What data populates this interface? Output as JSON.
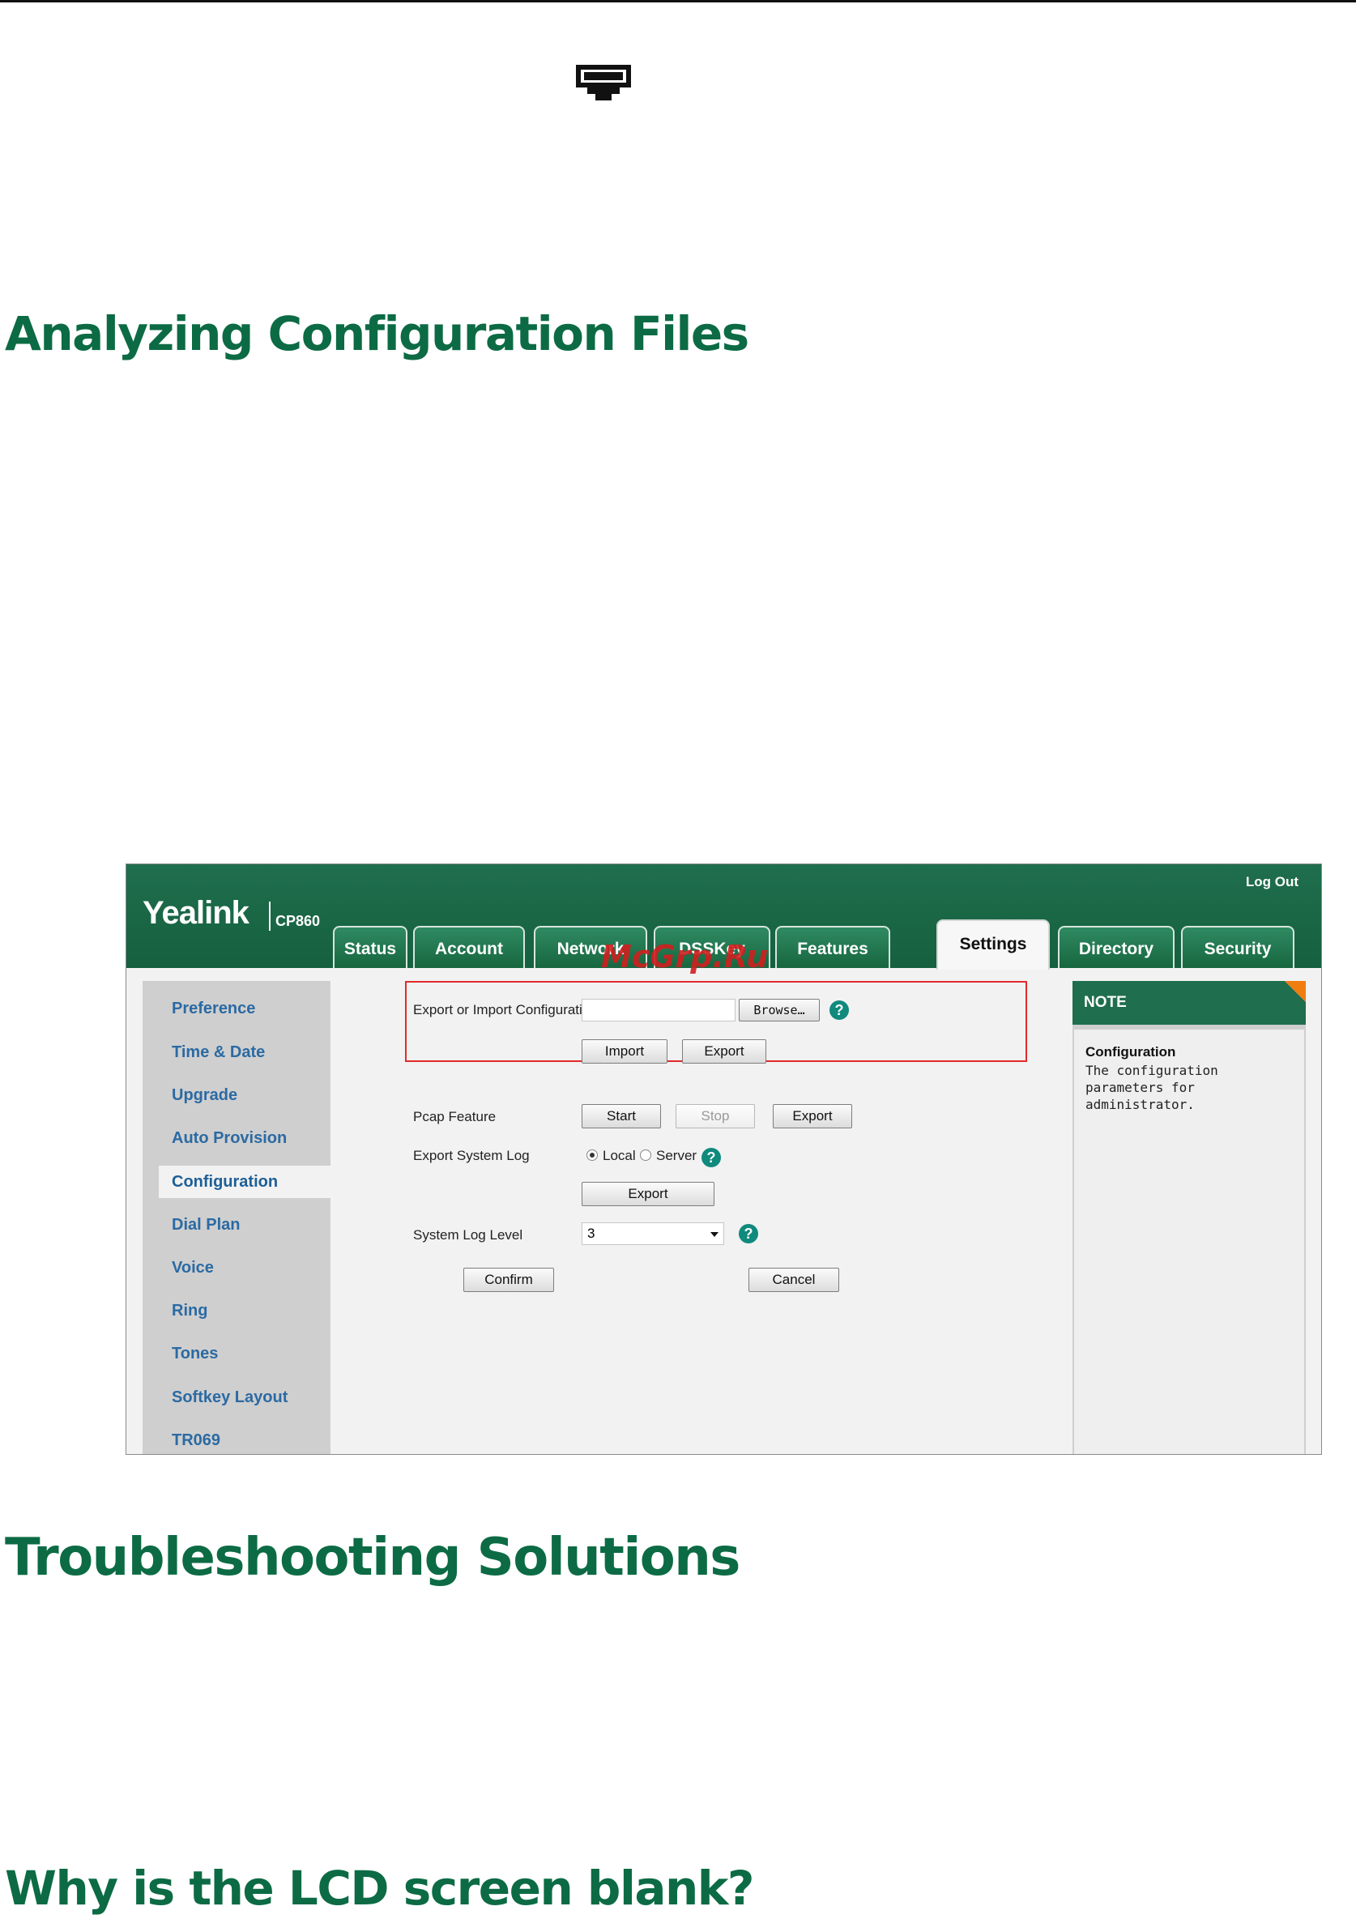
{
  "headings": {
    "analyzing": "Analyzing Configuration Files",
    "troubleshooting": "Troubleshooting Solutions",
    "lcd": "Why is the LCD screen blank?"
  },
  "screenshot": {
    "logo": "Yealink",
    "model": "CP860",
    "logout": "Log Out",
    "watermark": "McGrp.Ru",
    "tabs": [
      {
        "label": "Status"
      },
      {
        "label": "Account"
      },
      {
        "label": "Network"
      },
      {
        "label": "DSSKey"
      },
      {
        "label": "Features"
      },
      {
        "label": "Settings",
        "active": true
      },
      {
        "label": "Directory"
      },
      {
        "label": "Security"
      }
    ],
    "sidebar": [
      {
        "label": "Preference"
      },
      {
        "label": "Time & Date"
      },
      {
        "label": "Upgrade"
      },
      {
        "label": "Auto Provision"
      },
      {
        "label": "Configuration",
        "active": true
      },
      {
        "label": "Dial Plan"
      },
      {
        "label": "Voice"
      },
      {
        "label": "Ring"
      },
      {
        "label": "Tones"
      },
      {
        "label": "Softkey Layout"
      },
      {
        "label": "TR069"
      }
    ],
    "form": {
      "export_import_label": "Export or Import Configuration",
      "file_value": "",
      "browse_label": "Browse…",
      "import_label": "Import",
      "export_label": "Export",
      "pcap_label": "Pcap Feature",
      "start_label": "Start",
      "stop_label": "Stop",
      "pcap_export_label": "Export",
      "syslog_label": "Export System Log",
      "local_label": "Local",
      "server_label": "Server",
      "syslog_selected": "Local",
      "syslog_export_label": "Export",
      "log_level_label": "System Log Level",
      "log_level_value": "3",
      "confirm_label": "Confirm",
      "cancel_label": "Cancel",
      "help_glyph": "?"
    },
    "note": {
      "header": "NOTE",
      "title": "Configuration",
      "text": "The configuration parameters for administrator."
    }
  },
  "colors": {
    "heading_green": "#0c6b44",
    "bar_green": "#1f6e4d",
    "link_blue": "#2b6aa3",
    "highlight_red": "#e02a2a",
    "note_corner_orange": "#f07d10"
  },
  "icons": {
    "top": "network-port-icon"
  }
}
